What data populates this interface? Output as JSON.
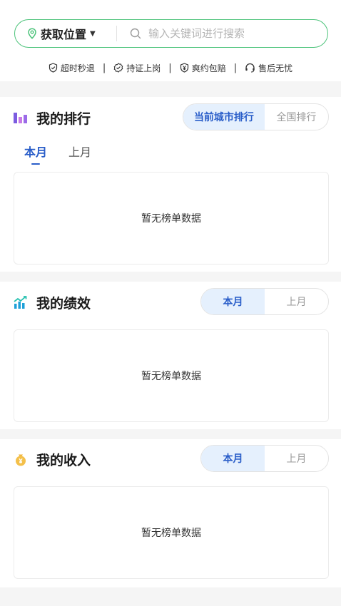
{
  "search": {
    "location_label": "获取位置",
    "placeholder": "输入关键词进行搜索"
  },
  "guarantees": [
    "超时秒退",
    "持证上岗",
    "爽约包赔",
    "售后无忧"
  ],
  "ranking": {
    "title": "我的排行",
    "toggle": [
      "当前城市排行",
      "全国排行"
    ],
    "tabs": [
      "本月",
      "上月"
    ],
    "empty_text": "暂无榜单数据"
  },
  "performance": {
    "title": "我的绩效",
    "toggle": [
      "本月",
      "上月"
    ],
    "empty_text": "暂无榜单数据"
  },
  "income": {
    "title": "我的收入",
    "toggle": [
      "本月",
      "上月"
    ],
    "empty_text": "暂无榜单数据"
  },
  "colors": {
    "accent_green": "#4cc37a",
    "accent_blue": "#2a5ec9",
    "toggle_active_bg": "#e5f0fd"
  }
}
